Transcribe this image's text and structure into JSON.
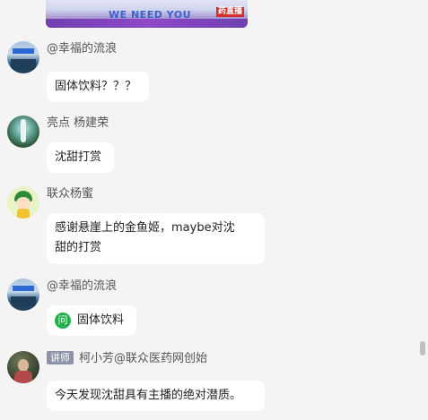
{
  "banner": {
    "text": "WE NEED YOU",
    "badge": "药直播"
  },
  "messages": [
    {
      "sender": "@幸福的流浪",
      "avatar": "city-avatar",
      "text": "固体饮料？？？"
    },
    {
      "sender": "亮点 杨建荣",
      "avatar": "waterfall-avatar",
      "text": "沈甜打赏"
    },
    {
      "sender": "联众杨蜜",
      "avatar": "cartoon-girl-avatar",
      "text_line1": "感谢悬崖上的金鱼姬，maybe对沈",
      "text_line2": "甜的打赏"
    },
    {
      "sender": "@幸福的流浪",
      "avatar": "city-avatar",
      "question_icon": "问",
      "text": "固体饮料"
    },
    {
      "sender": "柯小芳@联众医药网创始",
      "role_tag": "讲师",
      "avatar": "person-avatar",
      "text": "今天发现沈甜具有主播的绝对潜质。"
    }
  ],
  "colors": {
    "background": "#f4f4f4",
    "bubble": "#ffffff",
    "question_icon": "#21b04b",
    "role_tag": "#8c93a8"
  }
}
